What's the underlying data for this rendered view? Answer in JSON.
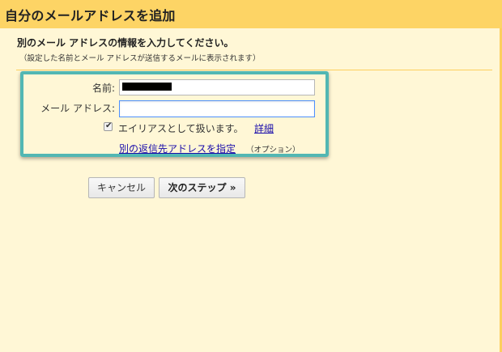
{
  "dialog": {
    "title": "自分のメールアドレスを追加",
    "heading": "別のメール アドレスの情報を入力してください。",
    "subheading": "（設定した名前とメール アドレスが送信するメールに表示されます）"
  },
  "form": {
    "name_label": "名前:",
    "name_value": "",
    "email_label": "メール アドレス:",
    "email_value": "",
    "alias_checked": true,
    "alias_label": "エイリアスとして扱います。",
    "details_link": "詳細",
    "reply_to_link": "別の返信先アドレスを指定",
    "optional_note": "（オプション）"
  },
  "buttons": {
    "cancel_label": "キャンセル",
    "next_label": "次のステップ »"
  },
  "colors": {
    "title_bar": "#fdd465",
    "background": "#fff7d6",
    "highlight": "#52b7b3",
    "link": "#1a0dab"
  }
}
